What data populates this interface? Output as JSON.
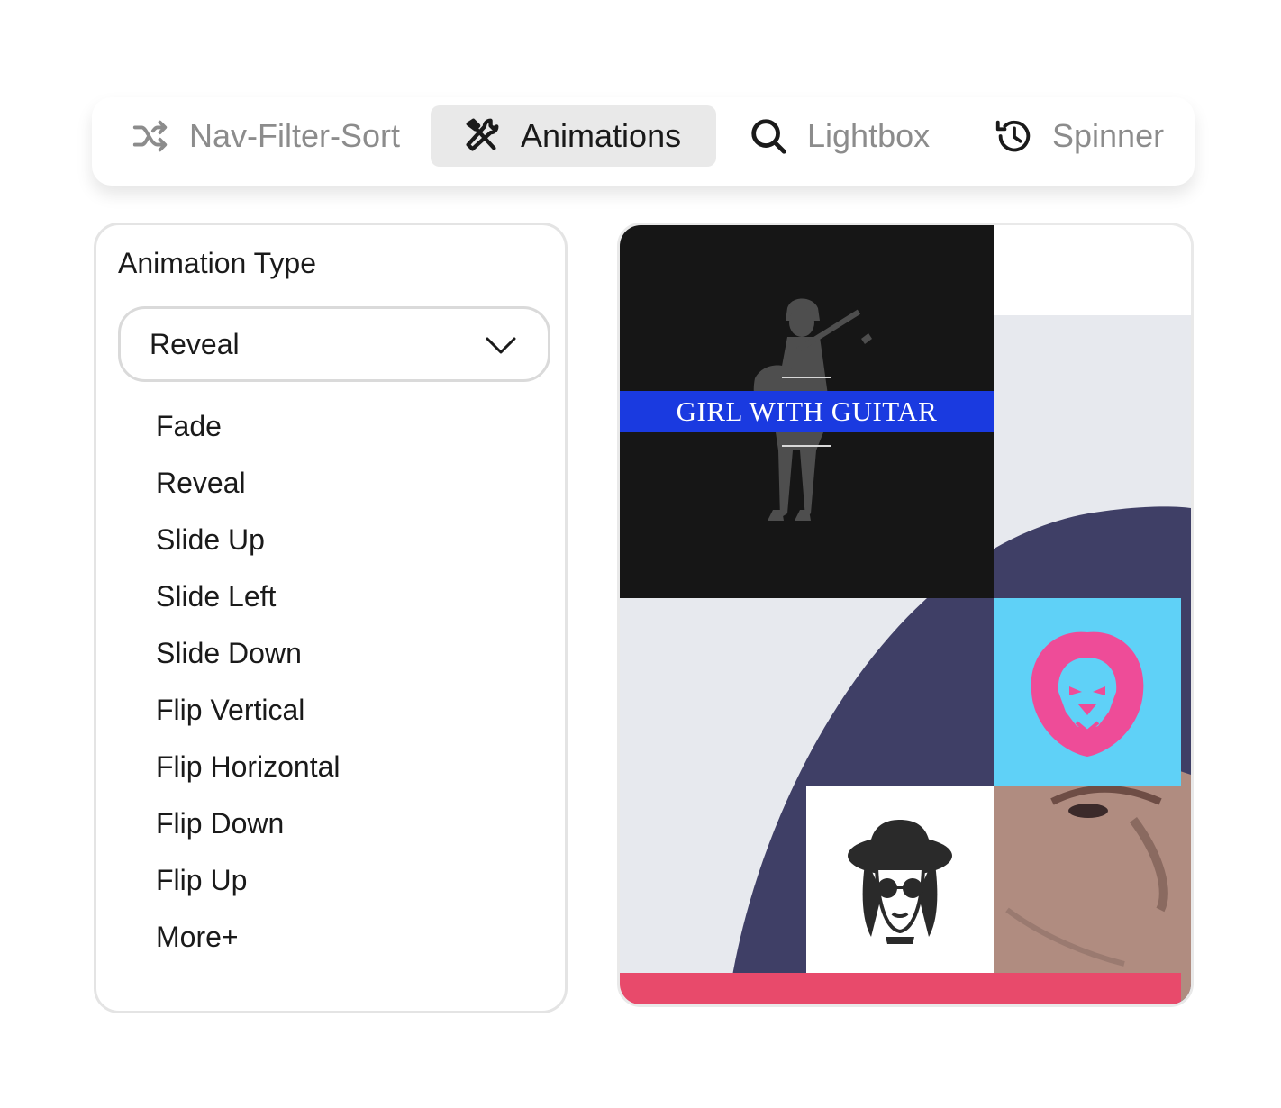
{
  "tabs": [
    {
      "label": "Nav-Filter-Sort",
      "icon": "shuffle-icon",
      "active": false
    },
    {
      "label": "Animations",
      "icon": "tools-icon",
      "active": true
    },
    {
      "label": "Lightbox",
      "icon": "search-icon",
      "active": false
    },
    {
      "label": "Spinner",
      "icon": "history-icon",
      "active": false
    }
  ],
  "panel": {
    "title": "Animation Type",
    "selected": "Reveal",
    "options": [
      "Fade",
      "Reveal",
      "Slide Up",
      "Slide Left",
      "Slide Down",
      "Flip Vertical",
      "Flip Horizontal",
      "Flip Down",
      "Flip Up",
      "More+"
    ]
  },
  "preview": {
    "banner_text": "GIRL WITH GUITAR",
    "colors": {
      "banner": "#1a3ae0",
      "dark_tile": "#161616",
      "blue_tile": "#5fd1f7",
      "lion": "#ee4c98",
      "pink_bar": "#e84a6b",
      "hat": "#3f3f66"
    }
  }
}
